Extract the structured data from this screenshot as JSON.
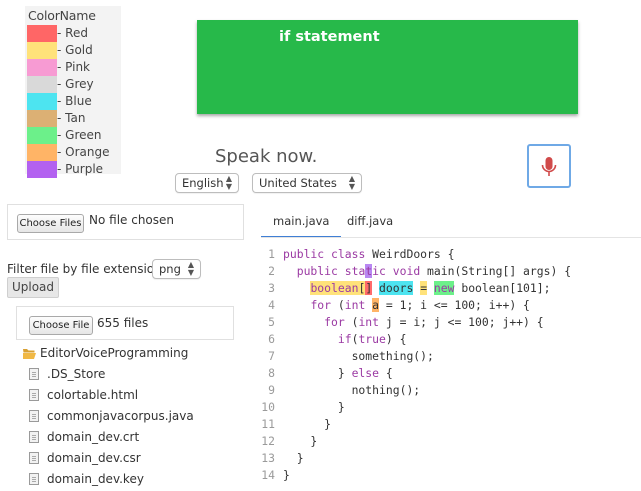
{
  "legend": {
    "title": "ColorName",
    "items": [
      {
        "label": "- Red",
        "color": "#ff6666"
      },
      {
        "label": "- Gold",
        "color": "#ffe27a"
      },
      {
        "label": "- Pink",
        "color": "#f79bd3"
      },
      {
        "label": "- Grey",
        "color": "#d9d9d9"
      },
      {
        "label": "- Blue",
        "color": "#4de4f0"
      },
      {
        "label": "- Tan",
        "color": "#dcb074"
      },
      {
        "label": "- Green",
        "color": "#6cf08a"
      },
      {
        "label": "- Orange",
        "color": "#ffb466"
      },
      {
        "label": "- Purple",
        "color": "#b361f0"
      }
    ]
  },
  "banner": {
    "text": "if statement",
    "color": "#27b94a"
  },
  "speech": {
    "prompt": "Speak now.",
    "language": "English",
    "dialect": "United States",
    "mic_icon": "microphone-icon"
  },
  "file_chooser": {
    "button": "Choose Files",
    "status": "No file chosen"
  },
  "filter": {
    "label": "Filter file by file extension:",
    "extension": "png",
    "upload_label": "Upload"
  },
  "folder": {
    "button": "Choose File",
    "status": "655 files",
    "name": "EditorVoiceProgramming",
    "files": [
      ".DS_Store",
      "colortable.html",
      "commonjavacorpus.java",
      "domain_dev.crt",
      "domain_dev.csr",
      "domain_dev.key"
    ]
  },
  "tabs": [
    {
      "label": "main.java",
      "active": true
    },
    {
      "label": "diff.java",
      "active": false
    }
  ],
  "code": {
    "line_numbers": [
      "1",
      "2",
      "3",
      "4",
      "5",
      "6",
      "7",
      "8",
      "9",
      "10",
      "11",
      "12",
      "13",
      "14"
    ],
    "l1": {
      "a": "public ",
      "b": "class ",
      "c": "WeirdDoors {"
    },
    "l2": {
      "a": "  public ",
      "b": "sta",
      "c": "t",
      "d": "ic ",
      "e": "void ",
      "f": "main(String[] args) {"
    },
    "l3": {
      "a": "    ",
      "b": "boolean",
      "c": "[",
      "d": "]",
      "e": " ",
      "f": "doors",
      "g": " ",
      "h": "=",
      "i": " ",
      "j": "new",
      "k": " boolean[101];"
    },
    "l4": {
      "a": "    ",
      "b": "for",
      "c": " (",
      "d": "int",
      "e": " ",
      "f": "a",
      "g": " = 1; i <= 100; i++) {"
    },
    "l5": {
      "a": "      ",
      "b": "for",
      "c": " (",
      "d": "int",
      "e": " j = i; j <= 100; j++) {"
    },
    "l6": {
      "a": "        ",
      "b": "if",
      "c": "(",
      "d": "true",
      "e": ") {"
    },
    "l7": "          something();",
    "l8": {
      "a": "        } ",
      "b": "else",
      "c": " {"
    },
    "l9": "          nothing();",
    "l10": "        }",
    "l11": "      }",
    "l12": "    }",
    "l13": "  }",
    "l14": "}"
  }
}
